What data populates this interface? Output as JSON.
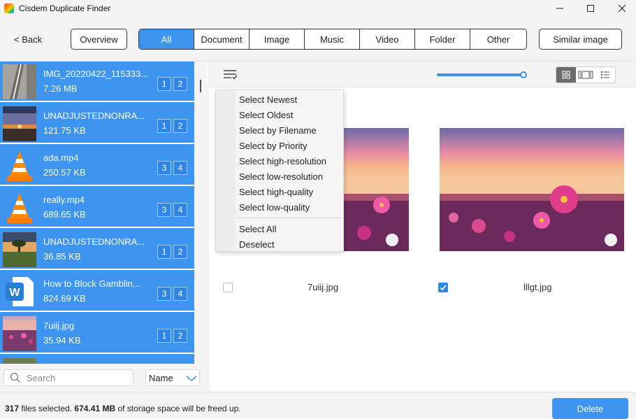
{
  "window": {
    "title": "Cisdem Duplicate Finder",
    "minimize_icon": "minimize-icon",
    "maximize_icon": "maximize-icon",
    "close_icon": "close-icon"
  },
  "toolbar": {
    "back_label": "< Back",
    "overview_label": "Overview",
    "similar_label": "Similar image",
    "tabs": [
      {
        "label": "All",
        "active": true
      },
      {
        "label": "Document",
        "active": false
      },
      {
        "label": "Image",
        "active": false
      },
      {
        "label": "Music",
        "active": false
      },
      {
        "label": "Video",
        "active": false
      },
      {
        "label": "Folder",
        "active": false
      },
      {
        "label": "Other",
        "active": false
      }
    ]
  },
  "file_list": {
    "items": [
      {
        "name": "IMG_20220422_115333...",
        "size": "7.26 MB",
        "badges": [
          "1",
          "2"
        ],
        "thumb": "photo-road"
      },
      {
        "name": "UNADJUSTEDNONRA...",
        "size": "121.75 KB",
        "badges": [
          "1",
          "2"
        ],
        "thumb": "photo-sunset"
      },
      {
        "name": "ada.mp4",
        "size": "250.57 KB",
        "badges": [
          "3",
          "4"
        ],
        "thumb": "vlc-cone-icon"
      },
      {
        "name": "really.mp4",
        "size": "689.65 KB",
        "badges": [
          "3",
          "4"
        ],
        "thumb": "vlc-cone-icon"
      },
      {
        "name": "UNADJUSTEDNONRA...",
        "size": "36.85 KB",
        "badges": [
          "1",
          "2"
        ],
        "thumb": "photo-tree"
      },
      {
        "name": "How to Block Gamblin...",
        "size": "824.69 KB",
        "badges": [
          "3",
          "4"
        ],
        "thumb": "word-doc-icon"
      },
      {
        "name": "7uiij.jpg",
        "size": "35.94 KB",
        "badges": [
          "1",
          "2"
        ],
        "thumb": "photo-flowers"
      }
    ]
  },
  "search": {
    "placeholder": "Search",
    "sort_value": "Name"
  },
  "menu": {
    "items": [
      "Select Newest",
      "Select Oldest",
      "Select by Filename",
      "Select by Priority",
      "Select high-resolution",
      "Select low-resolution",
      "Select high-quality",
      "Select low-quality"
    ],
    "items2": [
      "Select All",
      "Deselect"
    ]
  },
  "gallery": {
    "items": [
      {
        "filename": "7uiij.jpg",
        "checked": false
      },
      {
        "filename": "lllgt.jpg",
        "checked": true
      }
    ]
  },
  "status": {
    "files_count": "317",
    "files_text": "files selected.",
    "size": "674.41 MB",
    "size_text": "of storage space will be freed up.",
    "delete_label": "Delete"
  },
  "colors": {
    "accent": "#3d95f0",
    "toolbar_bg": "#f3f3f3"
  }
}
